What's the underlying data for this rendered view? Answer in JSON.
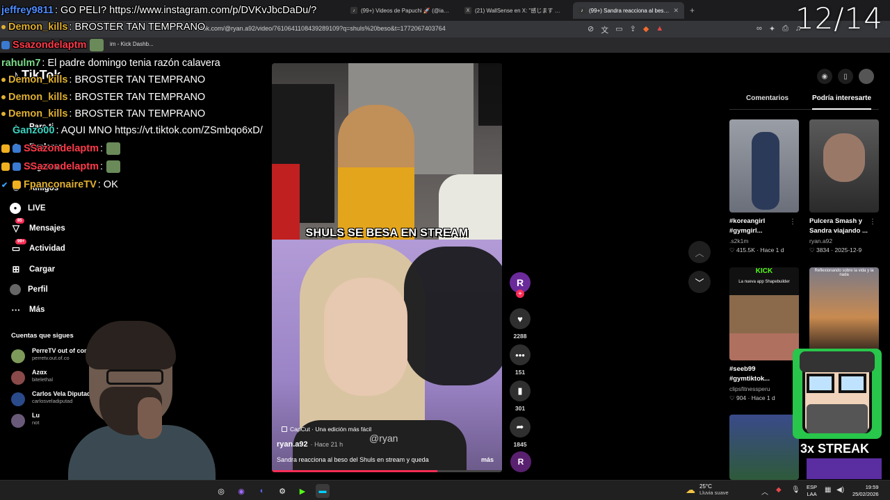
{
  "browser": {
    "tabs": [
      {
        "title": "(99+) Videos de Papuchi 🚀 (@iam_p",
        "icon": "tiktok-icon"
      },
      {
        "title": "(21) WallSense en X: \"感じます 😊 htt",
        "icon": "x-icon"
      },
      {
        "title": "(99+) Sandra reacciona al beso d",
        "icon": "tiktok-icon",
        "active": true
      }
    ],
    "new_tab": "+",
    "url": "tiktok.com/@ryan.a92/video/7610641108439289109?q=shuls%20beso&t=1772067403764",
    "bookmark": "im - Kick Dashb..."
  },
  "overlay_counter": "12/14",
  "chat": [
    {
      "user": "jeffrey9811",
      "color": "#4f8cff",
      "text": ": GO PELI? https://www.instagram.com/p/DVKvJbcDaDu/?"
    },
    {
      "user": "Demon_kills",
      "color": "#e0b030",
      "text": ": BROSTER TAN TEMPRANO"
    },
    {
      "user": "Ssazondelaptm",
      "color": "#ff3a4a",
      "text": ""
    },
    {
      "user": "rahulm7",
      "color": "#7ddc8a",
      "text": ": El padre domingo tenia razón calavera"
    },
    {
      "user": "Demon_kills",
      "color": "#e0b030",
      "text": ": BROSTER TAN TEMPRANO"
    },
    {
      "user": "Demon_kills",
      "color": "#e0b030",
      "text": ": BROSTER TAN TEMPRANO"
    },
    {
      "user": "Demon_kills",
      "color": "#e0b030",
      "text": ": BROSTER TAN TEMPRANO"
    },
    {
      "user": "Ganzo00",
      "color": "#3ad3c0",
      "text": ": AQUI MNO https://vt.tiktok.com/ZSmbqo6xD/"
    },
    {
      "user": "SSazondelaptm",
      "color": "#ff3a4a",
      "text": ":"
    },
    {
      "user": "SSazondelaptm",
      "color": "#ff3a4a",
      "text": ":"
    },
    {
      "user": "FpanconaireTV",
      "color": "#e0b030",
      "text": ": OK"
    }
  ],
  "tiktok": {
    "logo": "TikTok",
    "nav": [
      {
        "label": "Para ti",
        "icon": "home-icon"
      },
      {
        "label": "Explorar",
        "icon": "compass-icon"
      },
      {
        "label": "Siguiendo",
        "icon": "following-icon"
      },
      {
        "label": "Amigos",
        "icon": "friends-icon"
      },
      {
        "label": "LIVE",
        "icon": "live-icon"
      },
      {
        "label": "Mensajes",
        "icon": "message-icon",
        "badge": "85"
      },
      {
        "label": "Actividad",
        "icon": "inbox-icon",
        "badge": "99+"
      },
      {
        "label": "Cargar",
        "icon": "upload-icon"
      },
      {
        "label": "Perfil",
        "icon": "profile-icon"
      },
      {
        "label": "Más",
        "icon": "more-icon"
      }
    ],
    "following_title": "Cuentas que sigues",
    "following": [
      {
        "name": "PerreTV out of cont",
        "handle": "perretv.out.of.co"
      },
      {
        "name": "Azαx",
        "handle": "bitelethal"
      },
      {
        "name": "Carlos Vela Diputad",
        "handle": "carlosveladiputad"
      },
      {
        "name": "Lu",
        "handle": "not"
      }
    ]
  },
  "video": {
    "caption": "SHULS SE BESA EN STREAM",
    "capcut": "CapCut · Una edición más fácil",
    "watermark": "@ryan",
    "author": "ryan.a92",
    "time": "· Hace 21 h",
    "description": "Sandra reacciona al beso del Shuls en stream y queda",
    "more": "más",
    "progress": 0.72
  },
  "actions": {
    "avatar_letter": "R",
    "likes": "2288",
    "comments": "151",
    "saves": "301",
    "shares": "1845"
  },
  "right_panel": {
    "tabs": [
      "Comentarios",
      "Podría interesarte"
    ],
    "cards": [
      {
        "title1": "#koreangirl",
        "title2": "#gymgirl...",
        "author": ".s2k1m",
        "meta": "♡ 415.5K · Hace 1 d",
        "bg": "#8a8d94"
      },
      {
        "title1": "Pulcera Smash y",
        "title2": "Sandra viajando ...",
        "author": "ryan.a92",
        "meta": "♡ 3834 · 2025-12-9",
        "bg": "#4a4a4a"
      },
      {
        "title1": "#seeb99",
        "title2": "#gymtiktok...",
        "author": "clipsfitnessperu",
        "meta": "♡ 904 · Hace 1 d",
        "bg": "#1a1a1a",
        "top_text": "KICK",
        "sub_text": "La nueva app Shapebuilder"
      },
      {
        "title1": "",
        "title2": "",
        "author": "",
        "meta": "",
        "bg": "#c27a40",
        "top_text": "Reflexionando sobre la vida y la nada"
      }
    ]
  },
  "overlay_streak": "3x STREAK",
  "taskbar": {
    "weather_temp": "25°C",
    "weather_desc": "Lluvia suave",
    "lang1": "ESP",
    "lang2": "LAA",
    "time": "19:59",
    "date": "25/02/2026"
  }
}
